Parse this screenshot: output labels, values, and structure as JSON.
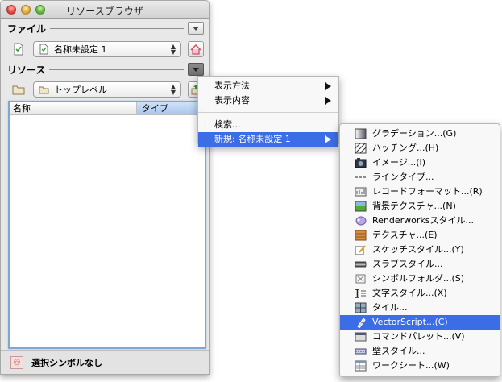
{
  "window": {
    "title": "リソースブラウザ"
  },
  "file_section": {
    "label": "ファイル",
    "selected_file": "名称未設定 1"
  },
  "resource_section": {
    "label": "リソース",
    "selected_folder": "トップレベル"
  },
  "list": {
    "columns": [
      "名称",
      "タイプ"
    ]
  },
  "status": {
    "text": "選択シンボルなし"
  },
  "context_menu": {
    "items": [
      {
        "label": "表示方法",
        "submenu": true
      },
      {
        "label": "表示内容",
        "submenu": true
      },
      {
        "label": "検索..."
      },
      {
        "label": "新規: 名称未設定 1",
        "submenu": true,
        "highlighted": true
      }
    ]
  },
  "new_submenu": {
    "items": [
      {
        "label": "グラデーション...(G)",
        "icon": "gradient-icon"
      },
      {
        "label": "ハッチング...(H)",
        "icon": "hatch-icon"
      },
      {
        "label": "イメージ...(I)",
        "icon": "image-icon"
      },
      {
        "label": "ラインタイプ...",
        "icon": "linetype-icon"
      },
      {
        "label": "レコードフォーマット...(R)",
        "icon": "record-format-icon"
      },
      {
        "label": "背景テクスチャ...(N)",
        "icon": "background-texture-icon"
      },
      {
        "label": "Renderworksスタイル...",
        "icon": "renderworks-style-icon"
      },
      {
        "label": "テクスチャ...(E)",
        "icon": "texture-icon"
      },
      {
        "label": "スケッチスタイル...(Y)",
        "icon": "sketch-style-icon"
      },
      {
        "label": "スラブスタイル...",
        "icon": "slab-style-icon"
      },
      {
        "label": "シンボルフォルダ...(S)",
        "icon": "symbol-folder-icon"
      },
      {
        "label": "文字スタイル...(X)",
        "icon": "text-style-icon"
      },
      {
        "label": "タイル...",
        "icon": "tile-icon"
      },
      {
        "label": "VectorScript...(C)",
        "icon": "vectorscript-icon",
        "highlighted": true
      },
      {
        "label": "コマンドパレット...(V)",
        "icon": "command-palette-icon"
      },
      {
        "label": "壁スタイル...",
        "icon": "wall-style-icon"
      },
      {
        "label": "ワークシート...(W)",
        "icon": "worksheet-icon"
      }
    ]
  },
  "colors": {
    "highlight": "#3b6de6",
    "list_focus": "#7ea6d8"
  }
}
